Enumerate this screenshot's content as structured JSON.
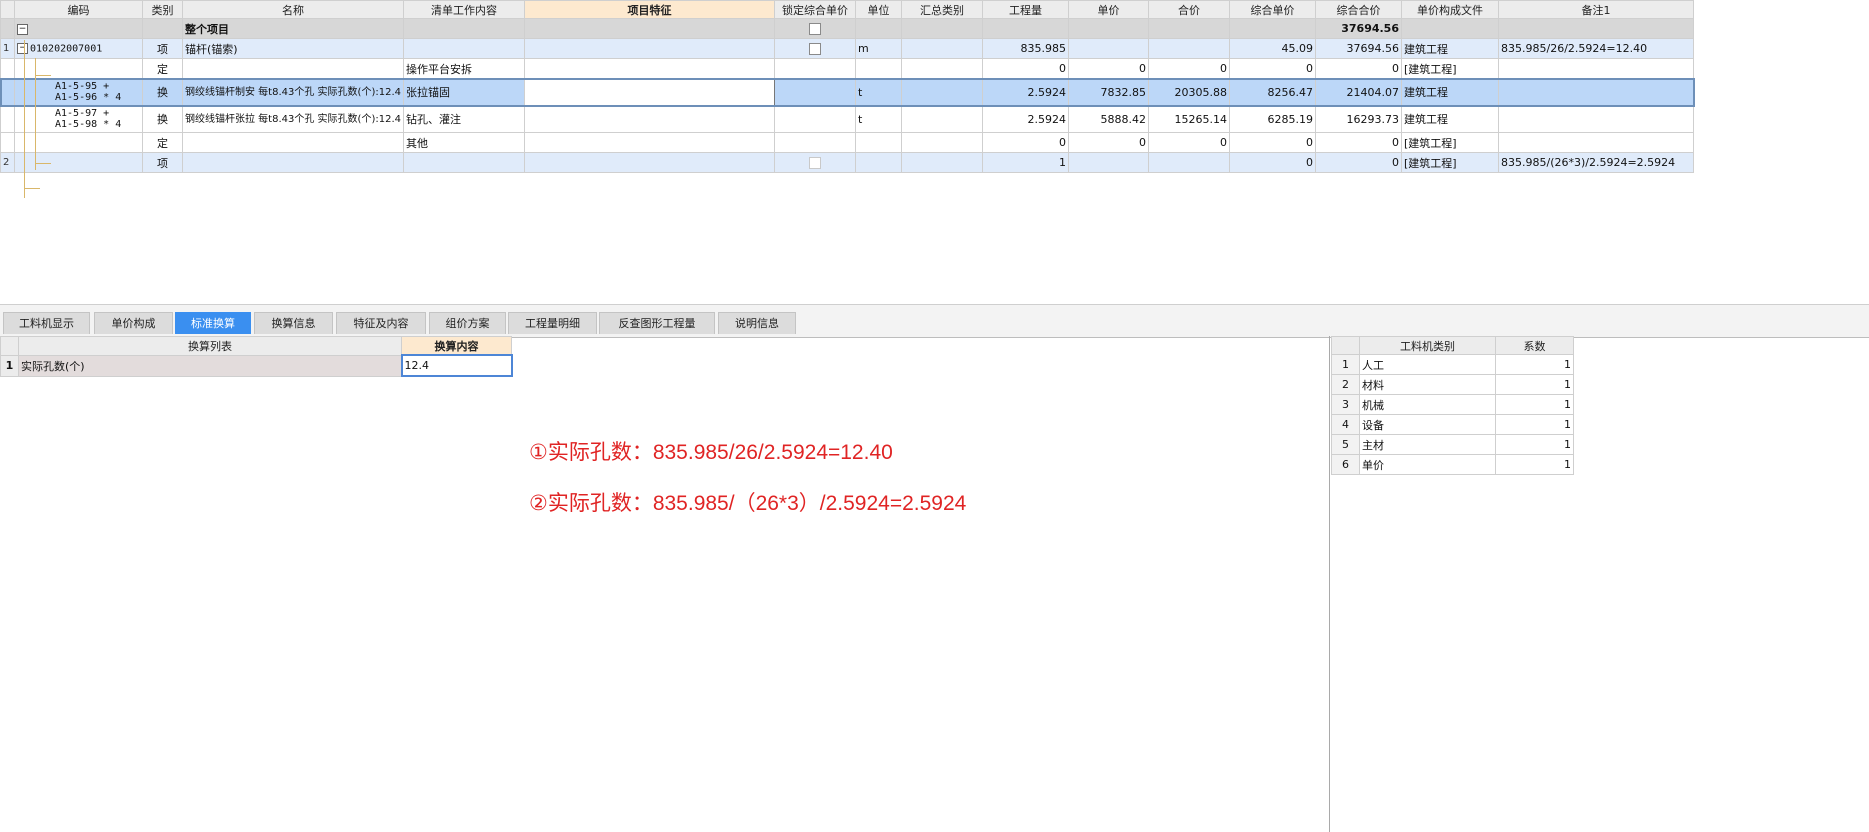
{
  "top_grid": {
    "headers": [
      "编码",
      "类别",
      "名称",
      "清单工作内容",
      "项目特征",
      "锁定综合单价",
      "单位",
      "汇总类别",
      "工程量",
      "单价",
      "合价",
      "综合单价",
      "综合合价",
      "单价构成文件",
      "备注1"
    ],
    "summary": {
      "label": "整个项目",
      "total": "37694.56"
    },
    "rows": [
      {
        "num": "1",
        "code": "010202007001",
        "type": "项",
        "name": "锚杆(锚索)",
        "work": "",
        "feature": "",
        "unit": "m",
        "summary_cat": "",
        "qty": "835.985",
        "price": "",
        "total": "",
        "comp_price": "45.09",
        "comp_total": "37694.56",
        "file": "建筑工程",
        "remark": "835.985/26/2.5924=12.40"
      },
      {
        "num": "",
        "code": "",
        "type": "定",
        "name": "",
        "work": "操作平台安拆",
        "feature": "",
        "unit": "",
        "summary_cat": "",
        "qty": "0",
        "price": "0",
        "total": "0",
        "comp_price": "0",
        "comp_total": "0",
        "file": "[建筑工程]",
        "remark": ""
      },
      {
        "num": "",
        "code_line1": "A1-5-95 +",
        "code_line2": "A1-5-96 * 4",
        "type": "换",
        "name": "钢绞线锚杆制安 每t8.43个孔 实际孔数(个):12.4",
        "work": "张拉锚固",
        "feature": "",
        "unit": "t",
        "summary_cat": "",
        "qty": "2.5924",
        "price": "7832.85",
        "total": "20305.88",
        "comp_price": "8256.47",
        "comp_total": "21404.07",
        "file": "建筑工程",
        "remark": ""
      },
      {
        "num": "",
        "code_line1": "A1-5-97 +",
        "code_line2": "A1-5-98 * 4",
        "type": "换",
        "name": "钢绞线锚杆张拉 每t8.43个孔 实际孔数(个):12.4",
        "work": "钻孔、灌注",
        "feature": "",
        "unit": "t",
        "summary_cat": "",
        "qty": "2.5924",
        "price": "5888.42",
        "total": "15265.14",
        "comp_price": "6285.19",
        "comp_total": "16293.73",
        "file": "建筑工程",
        "remark": ""
      },
      {
        "num": "",
        "code": "",
        "type": "定",
        "name": "",
        "work": "其他",
        "feature": "",
        "unit": "",
        "summary_cat": "",
        "qty": "0",
        "price": "0",
        "total": "0",
        "comp_price": "0",
        "comp_total": "0",
        "file": "[建筑工程]",
        "remark": ""
      },
      {
        "num": "2",
        "code": "",
        "type": "项",
        "name": "",
        "work": "",
        "feature": "",
        "unit": "",
        "summary_cat": "",
        "qty": "1",
        "price": "",
        "total": "",
        "comp_price": "0",
        "comp_total": "0",
        "file": "[建筑工程]",
        "remark": "835.985/(26*3)/2.5924=2.5924"
      }
    ]
  },
  "tabs": [
    "工料机显示",
    "单价构成",
    "标准换算",
    "换算信息",
    "特征及内容",
    "组价方案",
    "工程量明细",
    "反查图形工程量",
    "说明信息"
  ],
  "active_tab": "标准换算",
  "conversion": {
    "headers": [
      "换算列表",
      "换算内容"
    ],
    "rows": [
      {
        "num": "1",
        "label": "实际孔数(个)",
        "value": "12.4"
      }
    ]
  },
  "coefficients": {
    "headers": [
      "工料机类别",
      "系数"
    ],
    "rows": [
      {
        "num": "1",
        "category": "人工",
        "value": "1"
      },
      {
        "num": "2",
        "category": "材料",
        "value": "1"
      },
      {
        "num": "3",
        "category": "机械",
        "value": "1"
      },
      {
        "num": "4",
        "category": "设备",
        "value": "1"
      },
      {
        "num": "5",
        "category": "主材",
        "value": "1"
      },
      {
        "num": "6",
        "category": "单价",
        "value": "1"
      }
    ]
  },
  "annotations": {
    "note1": "①实际孔数：835.985/26/2.5924=12.40",
    "note2": "②实际孔数：835.985/（26*3）/2.5924=2.5924"
  },
  "colors": {
    "active_tab": "#3a8ff0",
    "annotation": "#e02424",
    "header_highlight": "#fde9cf",
    "selected_row": "#bcd7f8"
  }
}
